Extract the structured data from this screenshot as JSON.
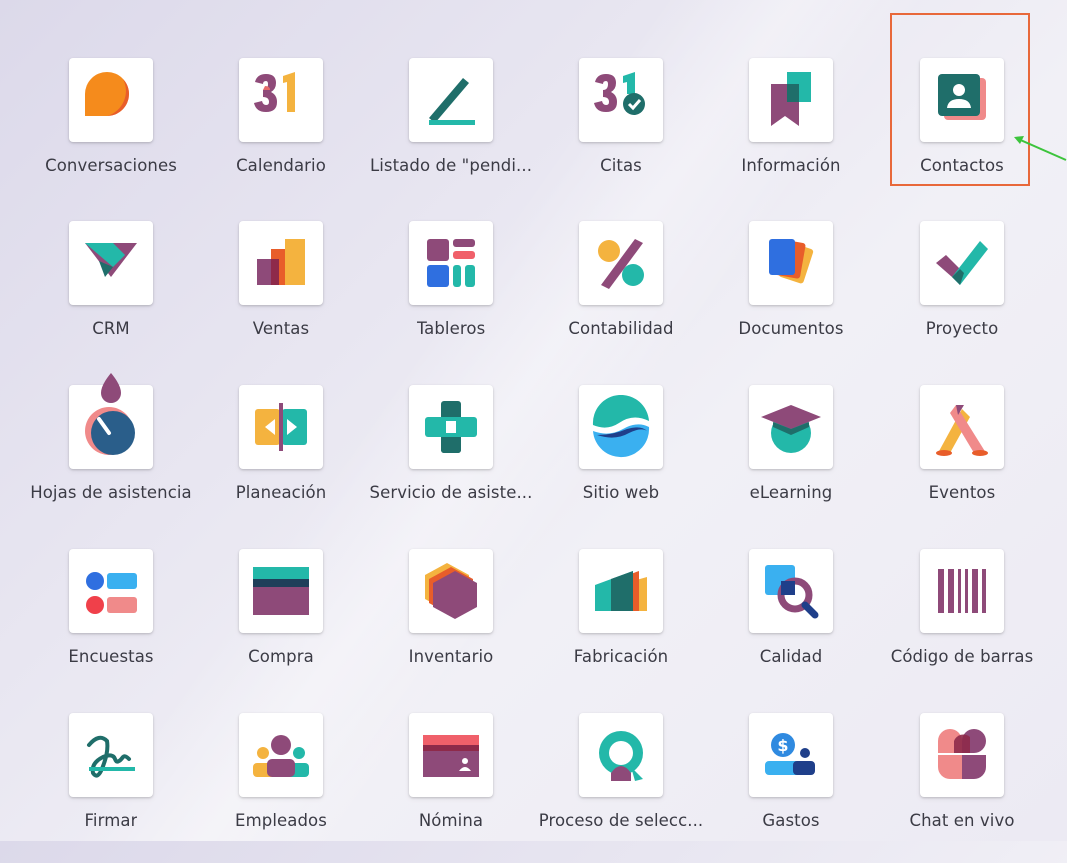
{
  "apps": [
    {
      "label": "Conversaciones",
      "icon": "chat-bubble-icon"
    },
    {
      "label": "Calendario",
      "icon": "calendar-icon"
    },
    {
      "label": "Listado de \"pendi...",
      "icon": "pen-todo-icon"
    },
    {
      "label": "Citas",
      "icon": "appointment-check-icon"
    },
    {
      "label": "Información",
      "icon": "bookmark-knowledge-icon"
    },
    {
      "label": "Contactos",
      "icon": "contact-card-icon"
    },
    {
      "label": "CRM",
      "icon": "handshake-crm-icon"
    },
    {
      "label": "Ventas",
      "icon": "sales-bars-icon"
    },
    {
      "label": "Tableros",
      "icon": "dashboard-icon"
    },
    {
      "label": "Contabilidad",
      "icon": "percent-icon"
    },
    {
      "label": "Documentos",
      "icon": "documents-cards-icon"
    },
    {
      "label": "Proyecto",
      "icon": "checkmark-project-icon"
    },
    {
      "label": "Hojas de asistencia",
      "icon": "timesheet-stopwatch-icon"
    },
    {
      "label": "Planeación",
      "icon": "planning-arrows-icon"
    },
    {
      "label": "Servicio de asiste...",
      "icon": "helpdesk-cross-icon"
    },
    {
      "label": "Sitio web",
      "icon": "globe-wave-icon"
    },
    {
      "label": "eLearning",
      "icon": "graduation-cap-icon"
    },
    {
      "label": "Eventos",
      "icon": "events-spotlight-icon"
    },
    {
      "label": "Encuestas",
      "icon": "survey-icon"
    },
    {
      "label": "Compra",
      "icon": "purchase-card-icon"
    },
    {
      "label": "Inventario",
      "icon": "inventory-hexagon-icon"
    },
    {
      "label": "Fabricación",
      "icon": "factory-icon"
    },
    {
      "label": "Calidad",
      "icon": "quality-magnifier-icon"
    },
    {
      "label": "Código de barras",
      "icon": "barcode-icon"
    },
    {
      "label": "Firmar",
      "icon": "signature-icon"
    },
    {
      "label": "Empleados",
      "icon": "employees-icon"
    },
    {
      "label": "Nómina",
      "icon": "payroll-card-icon"
    },
    {
      "label": "Proceso de selecc...",
      "icon": "recruitment-icon"
    },
    {
      "label": "Gastos",
      "icon": "expenses-dollar-icon"
    },
    {
      "label": "Chat en vivo",
      "icon": "livechat-icon"
    }
  ],
  "highlighted_app": "Contactos",
  "annotation_colors": {
    "highlight_box": "#e8683a",
    "arrow": "#3cc43c"
  }
}
